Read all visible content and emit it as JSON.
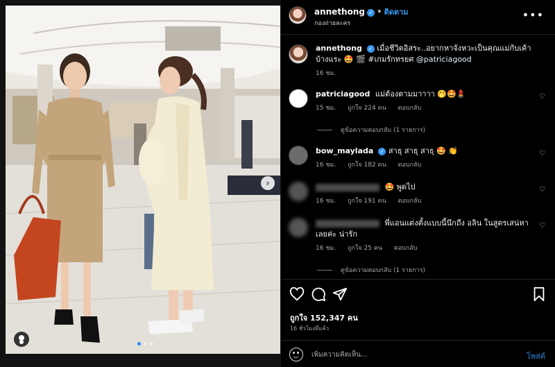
{
  "post": {
    "username": "annethong",
    "follow_label": "ติดตาม",
    "subtitle": "กองถ่ายละคร",
    "more_icon": "more-horizontal-icon"
  },
  "caption": {
    "username": "annethong",
    "text": "เมื่อชีวิตอิสระ..อยากหาจังหวะเป็นคุณแม่กับเค้าบ้างแระ 🤩 🎬 #เกมรักทรยศ",
    "mention": "@patriciagood",
    "time": "16 ชม."
  },
  "comments": [
    {
      "username": "patriciagood",
      "text": "แม่ต้องตามมาาาา 🤭🤩💄",
      "time": "15 ชม.",
      "likes": "ถูกใจ 224 คน",
      "reply": "ตอบกลับ",
      "view_replies": "ดูข้อความตอบกลับ (1 รายการ)"
    },
    {
      "username": "bow_maylada",
      "text": "สาธุ สาธุ สาธุ 🤩 👏",
      "time": "16 ชม.",
      "likes": "ถูกใจ 182 คน",
      "reply": "ตอบกลับ"
    },
    {
      "username": "",
      "text": "🤩 พูดไป",
      "time": "16 ชม.",
      "likes": "ถูกใจ 191 คน",
      "reply": "ตอบกลับ"
    },
    {
      "username": "",
      "text": "พี่แอนแต่งตั้งแบบนี้นึกถึง อลิน ในสูตรเสน่หาเลยค่ะ น่ารัก",
      "time": "16 ชม.",
      "likes": "ถูกใจ 25 คน",
      "reply": "ตอบกลับ",
      "view_replies": "ดูข้อความตอบกลับ (1 รายการ)"
    }
  ],
  "actions": {
    "likes": "ถูกใจ 152,347 คน",
    "ago": "16 ชั่วโมงที่แล้ว"
  },
  "composer": {
    "placeholder": "เพิ่มความคิดเห็น...",
    "post_label": "โพสต์"
  },
  "carousel": {
    "current": 1,
    "total": 3
  },
  "colors": {
    "accent": "#3797f0",
    "background": "#000000",
    "divider": "#262626"
  }
}
